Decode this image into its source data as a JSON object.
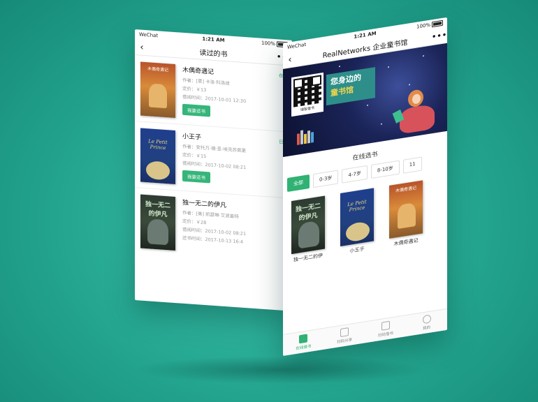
{
  "left_phone": {
    "status": {
      "carrier": "WeChat",
      "time": "1:21 AM",
      "battery": "100%"
    },
    "nav": {
      "back": "‹",
      "title": "读过的书",
      "more": "•••"
    },
    "books": [
      {
        "title": "木偶奇遇记",
        "author": "作者：[意] 卡洛·科洛迪",
        "price": "定价：￥13",
        "borrow_time": "借阅时间：2017-10-01  12:30",
        "status": "在读",
        "action": "我要还书",
        "cover_text": "木偶奇遇记"
      },
      {
        "title": "小王子",
        "author": "作者：安托万·德·圣-埃克苏佩里",
        "price": "定价：￥15",
        "borrow_time": "借阅时间：2017-10-02  08:21",
        "status": "已还",
        "action": "我要还书",
        "cover_text": "Le Petit Prince"
      },
      {
        "title": "独一无二的伊凡",
        "author": "作者：[美] 凯瑟琳·艾波盖特",
        "price": "定价：￥28",
        "borrow_time": "借阅时间：2017-10-02  08:21",
        "return_time": "还书时间：2017-10-13  16:4",
        "cover_text": "独一无二的伊凡"
      }
    ]
  },
  "right_phone": {
    "status": {
      "carrier": "WeChat",
      "time": "1:21 AM",
      "battery": "100%"
    },
    "nav": {
      "back": "‹",
      "title": "RealNetworks 企业童书馆",
      "more": "•••"
    },
    "banner": {
      "slogan_line1": "您身边的",
      "slogan_line2": "童书馆",
      "qr_caption": "瑞智童书"
    },
    "section_title": "在线选书",
    "filters": [
      "全部",
      "0-3岁",
      "4-7岁",
      "8-10岁",
      "11"
    ],
    "shelf": [
      {
        "title": "独一无二的伊",
        "cover_text": "独一无二的伊凡"
      },
      {
        "title": "小王子",
        "cover_text": "Le Petit Prince"
      },
      {
        "title": "木偶奇遇记",
        "cover_text": "木偶奇遇记"
      }
    ],
    "tabs": [
      "在线借书",
      "扫码分享",
      "扫码借书",
      "我的"
    ]
  }
}
